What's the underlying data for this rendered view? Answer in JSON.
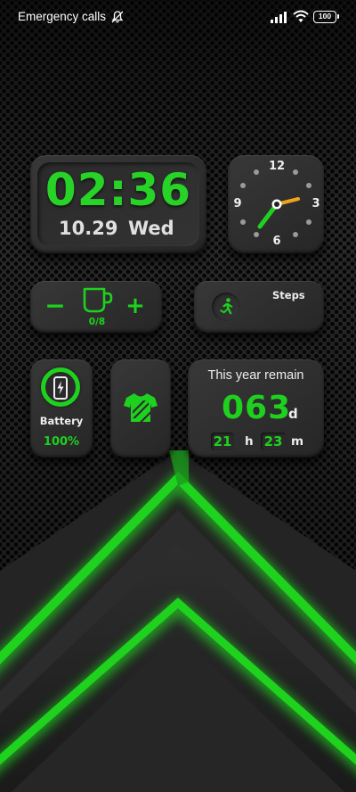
{
  "status_bar": {
    "carrier_text": "Emergency calls",
    "battery_level": "100",
    "icons": [
      "mute-icon",
      "signal-icon",
      "wifi-icon",
      "battery-icon"
    ]
  },
  "digital_clock": {
    "time": "02:36",
    "date": "10.29",
    "weekday": "Wed"
  },
  "analog_clock": {
    "numerals": {
      "top": "12",
      "right": "3",
      "bottom": "6",
      "left": "9"
    },
    "hand_colors": {
      "hour": "#f0a41c",
      "minute": "#1fd11f"
    }
  },
  "water_widget": {
    "minus_label": "−",
    "plus_label": "+",
    "count": "0/8",
    "icon": "cup-icon"
  },
  "steps_widget": {
    "label": "Steps",
    "icon": "running-person-icon"
  },
  "battery_widget": {
    "label": "Battery",
    "percent": "100%",
    "icon": "phone-charging-icon"
  },
  "theme_widget": {
    "icon": "t-shirt-icon"
  },
  "year_widget": {
    "title": "This year remain",
    "days": "063",
    "days_unit": "d",
    "hours": "21",
    "hours_unit": "h",
    "minutes": "23",
    "minutes_unit": "m"
  },
  "colors": {
    "accent": "#1fd11f",
    "card": "#303030",
    "background": "#1c1c1c"
  }
}
